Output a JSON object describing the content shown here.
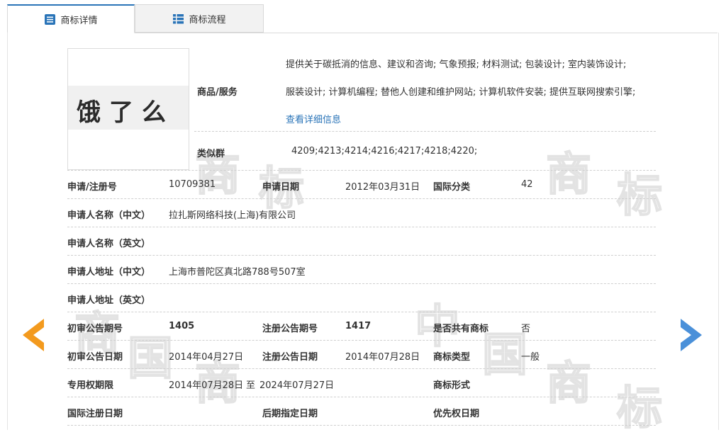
{
  "tabs": [
    {
      "label": "商标详情",
      "icon": "list-doc-icon"
    },
    {
      "label": "商标流程",
      "icon": "grid-list-icon"
    }
  ],
  "logo": {
    "text": "饿了么"
  },
  "watermark": {
    "chars": [
      "中",
      "国",
      "商",
      "标"
    ]
  },
  "goods": {
    "label": "商品/服务",
    "line1": "提供关于碳抵消的信息、建议和咨询; 气象预报; 材料测试; 包装设计; 室内装饰设计;",
    "line2": "服装设计; 计算机编程; 替他人创建和维护网站; 计算机软件安装; 提供互联网搜索引擎;",
    "detail_link": "查看详细信息"
  },
  "similar": {
    "label": "类似群",
    "value": "4209;4213;4214;4216;4217;4218;4220;"
  },
  "fields": {
    "reg_no_label": "申请/注册号",
    "reg_no": "10709381",
    "apply_date_label": "申请日期",
    "apply_date": "2012年03月31日",
    "intl_class_label": "国际分类",
    "intl_class": "42",
    "applicant_cn_label": "申请人名称（中文）",
    "applicant_cn": "拉扎斯网络科技(上海)有限公司",
    "applicant_en_label": "申请人名称（英文）",
    "address_cn_label": "申请人地址（中文）",
    "address_cn": "上海市普陀区真北路788号507室",
    "address_en_label": "申请人地址（英文）",
    "prelim_no_label": "初审公告期号",
    "prelim_no": "1405",
    "reg_pub_no_label": "注册公告期号",
    "reg_pub_no": "1417",
    "shared_label": "是否共有商标",
    "shared": "否",
    "prelim_date_label": "初审公告日期",
    "prelim_date": "2014年04月27日",
    "reg_pub_date_label": "注册公告日期",
    "reg_pub_date": "2014年07月28日",
    "type_label": "商标类型",
    "type": "一般",
    "term_label": "专用权期限",
    "term_start": "2014年07月28日",
    "term_sep": "至",
    "term_end": "2024年07月27日",
    "form_label": "商标形式",
    "intl_reg_date_label": "国际注册日期",
    "later_date_label": "后期指定日期",
    "priority_date_label": "优先权日期"
  },
  "colors": {
    "accent": "#2a74b8",
    "prev_arrow": "#f39a1e",
    "next_arrow": "#4a90d9"
  }
}
